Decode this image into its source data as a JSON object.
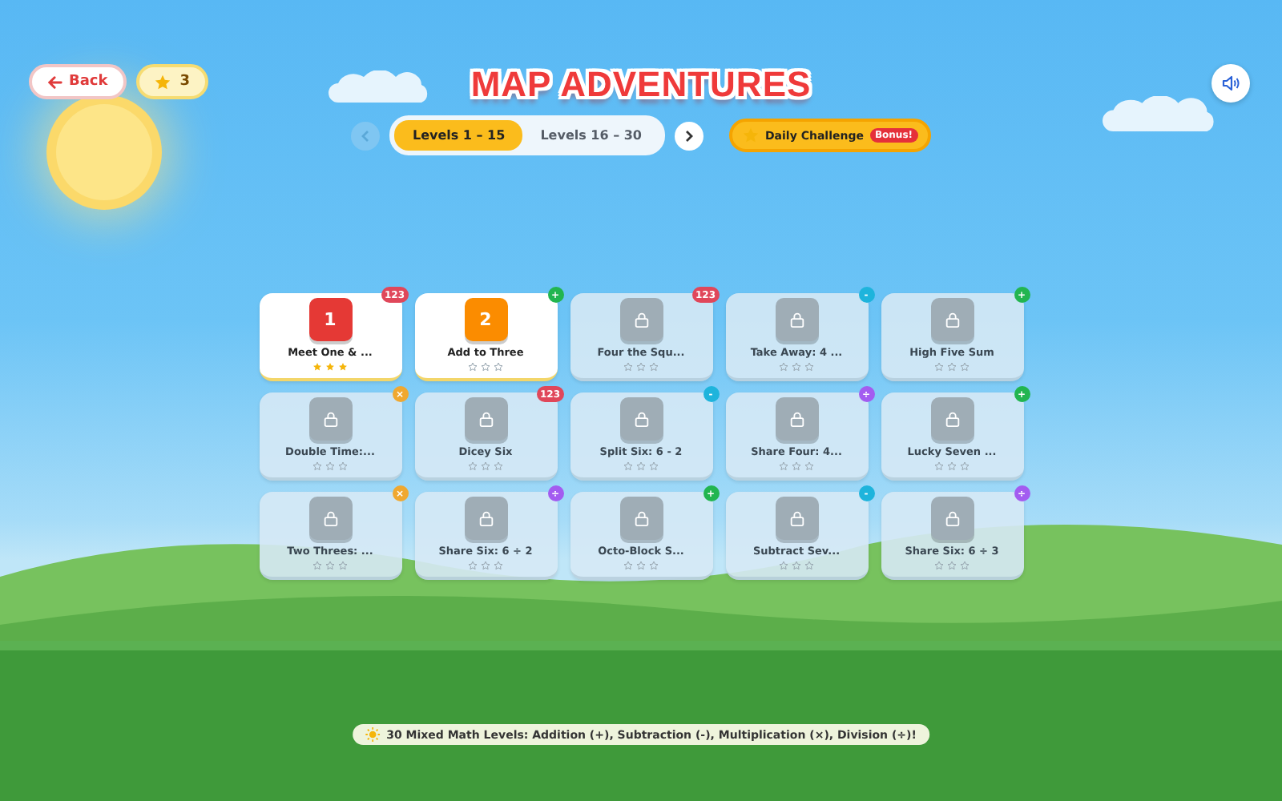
{
  "header": {
    "back_label": "Back",
    "star_count": "3",
    "title": "MAP ADVENTURES",
    "sound_on": true
  },
  "nav": {
    "prev_disabled": true,
    "next_disabled": false,
    "tabs": [
      {
        "label": "Levels 1 – 15",
        "selected": true
      },
      {
        "label": "Levels 16 – 30",
        "selected": false
      }
    ],
    "daily": {
      "label": "Daily Challenge",
      "badge": "Bonus!"
    }
  },
  "levels": [
    {
      "number": "1",
      "name": "Meet One & ...",
      "locked": false,
      "color": "#e53935",
      "stars": 3,
      "badge": {
        "text": "123",
        "color": "#e0475a"
      }
    },
    {
      "number": "2",
      "name": "Add to Three",
      "locked": false,
      "color": "#fb8c00",
      "stars": 0,
      "badge": {
        "text": "+",
        "color": "#22b550"
      }
    },
    {
      "name": "Four the Squ...",
      "locked": true,
      "stars": 0,
      "badge": {
        "text": "123",
        "color": "#e0475a"
      }
    },
    {
      "name": "Take Away: 4 ...",
      "locked": true,
      "stars": 0,
      "badge": {
        "text": "-",
        "color": "#1eb4dc"
      }
    },
    {
      "name": "High Five Sum",
      "locked": true,
      "stars": 0,
      "badge": {
        "text": "+",
        "color": "#22b550"
      }
    },
    {
      "name": "Double Time:...",
      "locked": true,
      "stars": 0,
      "badge": {
        "text": "×",
        "color": "#f0a830"
      }
    },
    {
      "name": "Dicey Six",
      "locked": true,
      "stars": 0,
      "badge": {
        "text": "123",
        "color": "#e0475a"
      }
    },
    {
      "name": "Split Six: 6 - 2",
      "locked": true,
      "stars": 0,
      "badge": {
        "text": "-",
        "color": "#1eb4dc"
      }
    },
    {
      "name": "Share Four: 4...",
      "locked": true,
      "stars": 0,
      "badge": {
        "text": "÷",
        "color": "#a35cf0"
      }
    },
    {
      "name": "Lucky Seven ...",
      "locked": true,
      "stars": 0,
      "badge": {
        "text": "+",
        "color": "#22b550"
      }
    },
    {
      "name": "Two Threes: ...",
      "locked": true,
      "stars": 0,
      "badge": {
        "text": "×",
        "color": "#f0a830"
      }
    },
    {
      "name": "Share Six: 6 ÷ 2",
      "locked": true,
      "stars": 0,
      "badge": {
        "text": "÷",
        "color": "#a35cf0"
      }
    },
    {
      "name": "Octo-Block S...",
      "locked": true,
      "stars": 0,
      "badge": {
        "text": "+",
        "color": "#22b550"
      }
    },
    {
      "name": "Subtract Sev...",
      "locked": true,
      "stars": 0,
      "badge": {
        "text": "-",
        "color": "#1eb4dc"
      }
    },
    {
      "name": "Share Six: 6 ÷ 3",
      "locked": true,
      "stars": 0,
      "badge": {
        "text": "÷",
        "color": "#a35cf0"
      }
    }
  ],
  "footer": {
    "text": "30 Mixed Math Levels: Addition (+), Subtraction (-), Multiplication (×), Division (÷)!"
  }
}
